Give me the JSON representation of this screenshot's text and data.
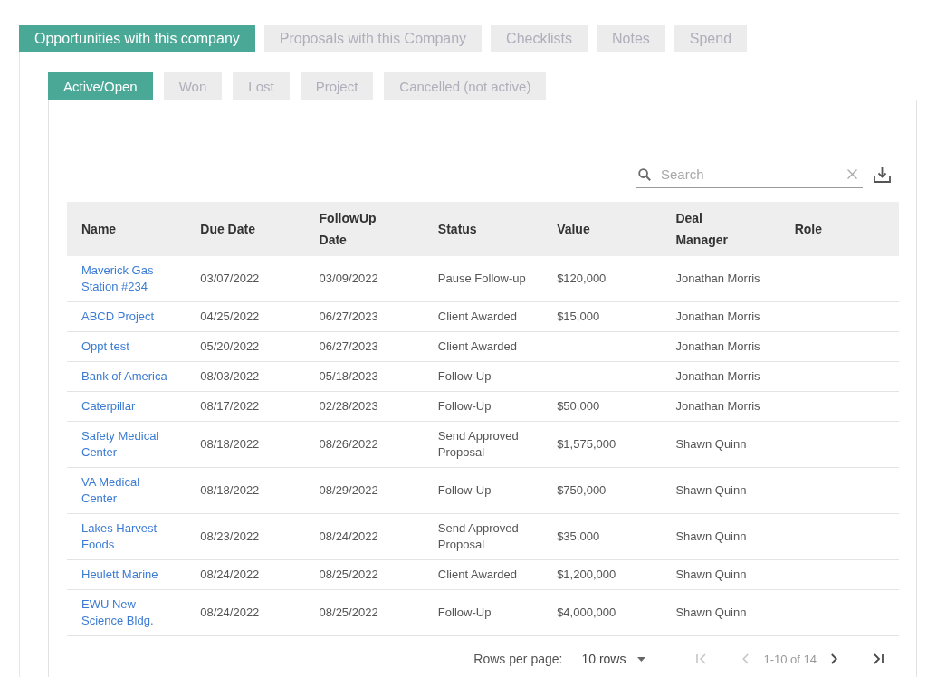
{
  "main_tabs": [
    {
      "label": "Opportunities with this company",
      "selected": true
    },
    {
      "label": "Proposals with this Company",
      "selected": false
    },
    {
      "label": "Checklists",
      "selected": false
    },
    {
      "label": "Notes",
      "selected": false
    },
    {
      "label": "Spend",
      "selected": false
    }
  ],
  "sub_tabs": [
    {
      "label": "Active/Open",
      "selected": true
    },
    {
      "label": "Won",
      "selected": false
    },
    {
      "label": "Lost",
      "selected": false
    },
    {
      "label": "Project",
      "selected": false
    },
    {
      "label": "Cancelled (not active)",
      "selected": false
    }
  ],
  "search": {
    "placeholder": "Search"
  },
  "table": {
    "columns": [
      "Name",
      "Due Date",
      "FollowUp Date",
      "Status",
      "Value",
      "Deal Manager",
      "Role"
    ],
    "rows": [
      {
        "name": "Maverick Gas Station #234",
        "due_date": "03/07/2022",
        "followup_date": "03/09/2022",
        "status": "Pause Follow-up",
        "value": "$120,000",
        "deal_manager": "Jonathan Morris"
      },
      {
        "name": "ABCD Project",
        "due_date": "04/25/2022",
        "followup_date": "06/27/2023",
        "status": "Client Awarded",
        "value": "$15,000",
        "deal_manager": "Jonathan Morris"
      },
      {
        "name": "Oppt test",
        "due_date": "05/20/2022",
        "followup_date": "06/27/2023",
        "status": "Client Awarded",
        "deal_manager": "Jonathan Morris"
      },
      {
        "name": "Bank of America",
        "due_date": "08/03/2022",
        "followup_date": "05/18/2023",
        "status": "Follow-Up",
        "deal_manager": "Jonathan Morris"
      },
      {
        "name": "Caterpillar",
        "due_date": "08/17/2022",
        "followup_date": "02/28/2023",
        "status": "Follow-Up",
        "value": "$50,000",
        "deal_manager": "Jonathan Morris"
      },
      {
        "name": "Safety Medical Center",
        "due_date": "08/18/2022",
        "followup_date": "08/26/2022",
        "status": "Send Approved Proposal",
        "value": "$1,575,000",
        "deal_manager": "Shawn Quinn"
      },
      {
        "name": "VA Medical Center",
        "due_date": "08/18/2022",
        "followup_date": "08/29/2022",
        "status": "Follow-Up",
        "value": "$750,000",
        "deal_manager": "Shawn Quinn"
      },
      {
        "name": "Lakes Harvest Foods",
        "due_date": "08/23/2022",
        "followup_date": "08/24/2022",
        "status": "Send Approved Proposal",
        "value": "$35,000",
        "deal_manager": "Shawn Quinn"
      },
      {
        "name": "Heulett Marine",
        "due_date": "08/24/2022",
        "followup_date": "08/25/2022",
        "status": "Client Awarded",
        "value": "$1,200,000",
        "deal_manager": "Shawn Quinn"
      },
      {
        "name": "EWU New Science Bldg.",
        "due_date": "08/24/2022",
        "followup_date": "08/25/2022",
        "status": "Follow-Up",
        "value": "$4,000,000",
        "deal_manager": "Shawn Quinn"
      }
    ]
  },
  "pagination": {
    "rows_per_page_label": "Rows per page:",
    "rows_per_page": "10 rows",
    "range": "1-10 of 14",
    "buttons": [
      {
        "kind": "first",
        "disabled": true
      },
      {
        "kind": "previous",
        "disabled": true
      },
      {
        "kind": "next",
        "disabled": false
      },
      {
        "kind": "last",
        "disabled": false
      }
    ]
  }
}
